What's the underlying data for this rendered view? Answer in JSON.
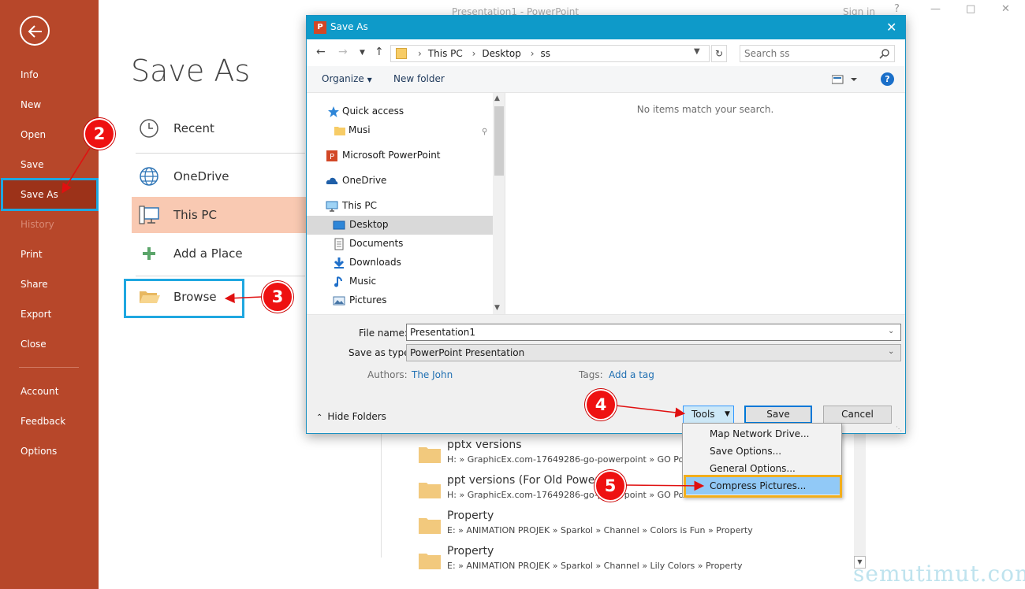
{
  "app": {
    "window_title": "Presentation1 - PowerPoint",
    "sign_in": "Sign in",
    "help": "?"
  },
  "sidebar": {
    "items": [
      {
        "label": "Info"
      },
      {
        "label": "New"
      },
      {
        "label": "Open"
      },
      {
        "label": "Save"
      },
      {
        "label": "Save As"
      },
      {
        "label": "History"
      },
      {
        "label": "Print"
      },
      {
        "label": "Share"
      },
      {
        "label": "Export"
      },
      {
        "label": "Close"
      },
      {
        "label": "Account"
      },
      {
        "label": "Feedback"
      },
      {
        "label": "Options"
      }
    ],
    "active": "Save As",
    "disabled": [
      "History"
    ]
  },
  "backstage": {
    "title": "Save As",
    "locations": [
      {
        "label": "Recent",
        "icon": "clock-icon"
      },
      {
        "label": "OneDrive",
        "icon": "globe-icon"
      },
      {
        "label": "This PC",
        "icon": "computer-icon"
      },
      {
        "label": "Add a Place",
        "icon": "plus-icon"
      },
      {
        "label": "Browse",
        "icon": "folder-open-icon"
      }
    ],
    "recent_folders": [
      {
        "name": "pptx versions",
        "path": "H: » GraphicEx.com-17649286-go-powerpoint » GO Powe"
      },
      {
        "name": "ppt versions (For Old PowerP",
        "path": "H: » GraphicEx.com-17649286-go-powerpoint » GO Power"
      },
      {
        "name": "Property",
        "path": "E: » ANIMATION PROJEK » Sparkol » Channel » Colors is Fun » Property"
      },
      {
        "name": "Property",
        "path": "E: » ANIMATION PROJEK » Sparkol » Channel » Lily Colors » Property"
      }
    ]
  },
  "dialog": {
    "title": "Save As",
    "address": {
      "crumbs": [
        "This PC",
        "Desktop",
        "ss"
      ]
    },
    "search": {
      "placeholder": "Search ss"
    },
    "toolbar": {
      "organize": "Organize",
      "new_folder": "New folder",
      "help": "?"
    },
    "tree": [
      {
        "label": "Quick access",
        "icon": "star-icon"
      },
      {
        "label": "Musi",
        "icon": "folder-icon"
      },
      {
        "label": "Microsoft PowerPoint",
        "icon": "powerpoint-icon"
      },
      {
        "label": "OneDrive",
        "icon": "cloud-icon"
      },
      {
        "label": "This PC",
        "icon": "computer-icon"
      },
      {
        "label": "Desktop",
        "icon": "desktop-icon"
      },
      {
        "label": "Documents",
        "icon": "documents-icon"
      },
      {
        "label": "Downloads",
        "icon": "download-icon"
      },
      {
        "label": "Music",
        "icon": "music-icon"
      },
      {
        "label": "Pictures",
        "icon": "pictures-icon"
      }
    ],
    "selected_tree": "Desktop",
    "empty_message": "No items match your search.",
    "file_name_label": "File name:",
    "file_name": "Presentation1",
    "save_type_label": "Save as type:",
    "save_type": "PowerPoint Presentation",
    "authors_label": "Authors:",
    "authors": "The John",
    "tags_label": "Tags:",
    "tags": "Add a tag",
    "hide_folders": "Hide Folders",
    "tools": "Tools",
    "save": "Save",
    "cancel": "Cancel"
  },
  "tools_menu": {
    "items": [
      {
        "label": "Map Network Drive..."
      },
      {
        "label": "Save Options..."
      },
      {
        "label": "General Options..."
      },
      {
        "label": "Compress Pictures..."
      }
    ],
    "highlighted": "Compress Pictures..."
  },
  "callouts": [
    "2",
    "3",
    "4",
    "5"
  ],
  "watermark": "semutimut.com",
  "colors": {
    "backstage_accent": "#b7472a",
    "dialog_title_bar": "#0e9ac9",
    "callout": "#ee1111",
    "highlight_box": "#1fa7e0",
    "menu_highlight_box": "#f2ae1c"
  }
}
